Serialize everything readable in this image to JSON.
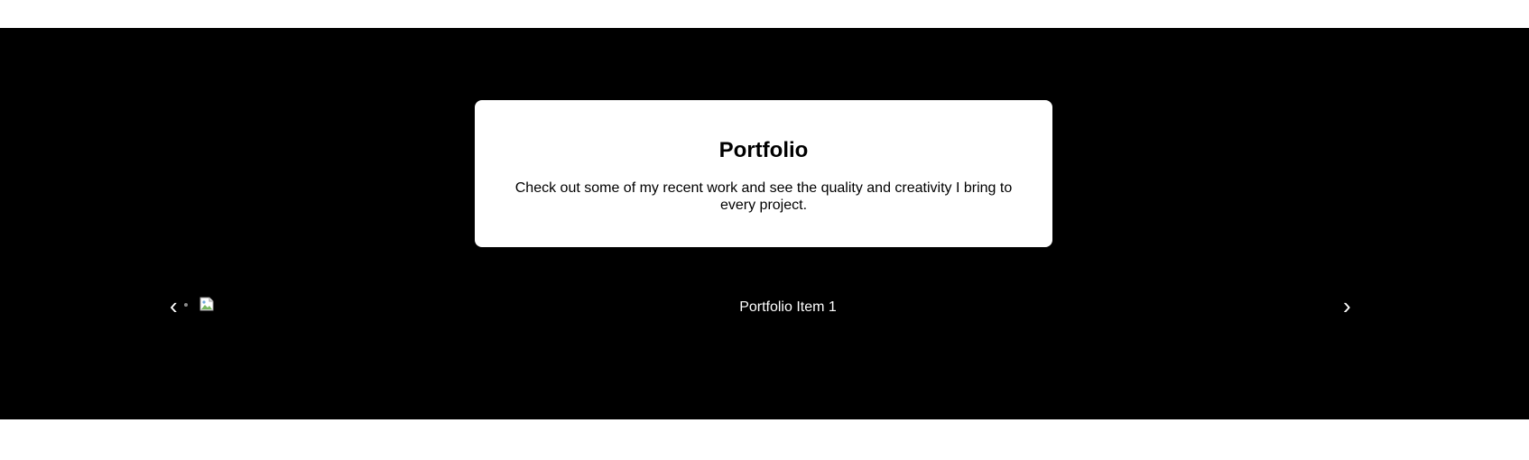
{
  "portfolio": {
    "title": "Portfolio",
    "description": "Check out some of my recent work and see the quality and creativity I bring to every project."
  },
  "carousel": {
    "prev_icon": "chevron-left-icon",
    "next_icon": "chevron-right-icon",
    "prev_glyph": "‹",
    "next_glyph": "›",
    "current_item_caption": "Portfolio Item 1",
    "image_state": "broken-image-icon"
  },
  "colors": {
    "section_background": "#000000",
    "card_background": "#ffffff",
    "page_background": "#ffffff"
  }
}
